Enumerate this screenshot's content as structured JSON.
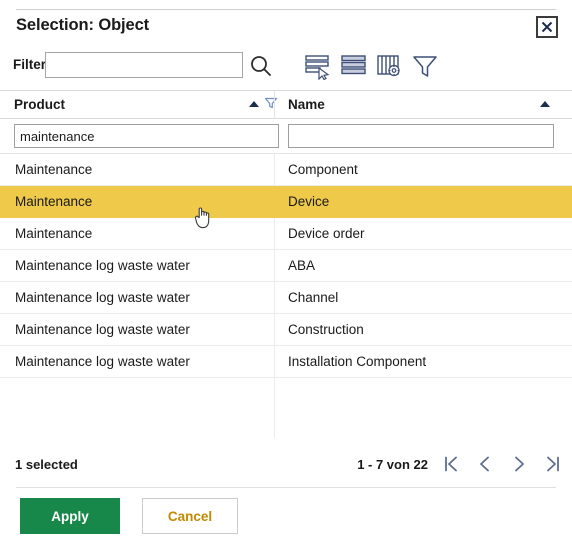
{
  "dialog": {
    "title": "Selection: Object",
    "close_label": "×"
  },
  "filter": {
    "label": "Filter",
    "value": "",
    "placeholder": "",
    "search_icon": "search-icon",
    "tools": [
      {
        "name": "select-rows-icon",
        "label": "Select rows"
      },
      {
        "name": "list-view-icon",
        "label": "List view"
      },
      {
        "name": "column-settings-icon",
        "label": "Column settings"
      },
      {
        "name": "funnel-filter-icon",
        "label": "Filter"
      }
    ]
  },
  "grid": {
    "columns": [
      {
        "key": "product",
        "label": "Product",
        "sort": "asc",
        "has_filter_icon": true
      },
      {
        "key": "name",
        "label": "Name",
        "sort": "asc",
        "has_filter_icon": false
      }
    ],
    "column_filters": [
      {
        "column": "product",
        "value": "maintenance",
        "placeholder": ""
      },
      {
        "column": "name",
        "value": "",
        "placeholder": ""
      }
    ],
    "rows": [
      {
        "product": "Maintenance",
        "name": "Component",
        "selected": false
      },
      {
        "product": "Maintenance",
        "name": "Device",
        "selected": true
      },
      {
        "product": "Maintenance",
        "name": "Device order",
        "selected": false
      },
      {
        "product": "Maintenance log waste water",
        "name": "ABA",
        "selected": false
      },
      {
        "product": "Maintenance log waste water",
        "name": "Channel",
        "selected": false
      },
      {
        "product": "Maintenance log waste water",
        "name": "Construction",
        "selected": false
      },
      {
        "product": "Maintenance log waste water",
        "name": "Installation Component",
        "selected": false
      }
    ]
  },
  "footer": {
    "selection_count": "1 selected",
    "page_info": "1 - 7 von 22",
    "pager": [
      {
        "name": "first-page-button",
        "glyph": "|<"
      },
      {
        "name": "previous-page-button",
        "glyph": "<"
      },
      {
        "name": "next-page-button",
        "glyph": ">"
      },
      {
        "name": "last-page-button",
        "glyph": ">|"
      }
    ]
  },
  "actions": {
    "apply_label": "Apply",
    "cancel_label": "Cancel"
  },
  "colors": {
    "selected_row": "#eec94a",
    "apply_green": "#18874a",
    "cancel_text": "#c18a00",
    "icon_blue": "#4a6fa5"
  }
}
